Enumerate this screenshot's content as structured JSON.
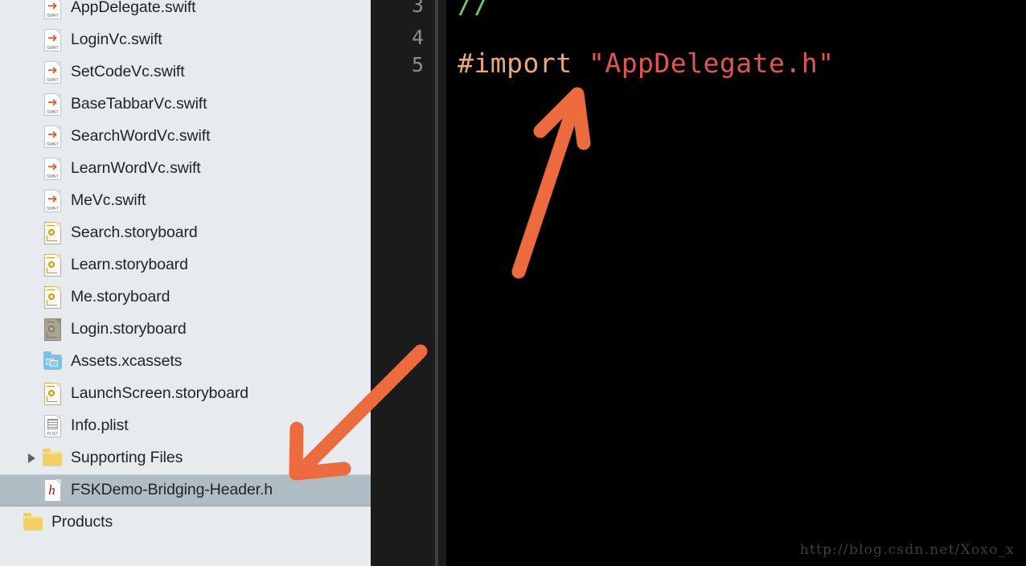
{
  "app": {
    "kind": "xcode-project-navigator-and-editor"
  },
  "sidebar": {
    "background_color": "#e7ebed",
    "selection_color": "#b0bcc3",
    "items": [
      {
        "label": "AppDelegate.swift",
        "icon": "swift-file-icon",
        "indent": 1,
        "twisty": false,
        "selected": false,
        "clipped": true
      },
      {
        "label": "LoginVc.swift",
        "icon": "swift-file-icon",
        "indent": 1,
        "twisty": false,
        "selected": false
      },
      {
        "label": "SetCodeVc.swift",
        "icon": "swift-file-icon",
        "indent": 1,
        "twisty": false,
        "selected": false
      },
      {
        "label": "BaseTabbarVc.swift",
        "icon": "swift-file-icon",
        "indent": 1,
        "twisty": false,
        "selected": false
      },
      {
        "label": "SearchWordVc.swift",
        "icon": "swift-file-icon",
        "indent": 1,
        "twisty": false,
        "selected": false
      },
      {
        "label": "LearnWordVc.swift",
        "icon": "swift-file-icon",
        "indent": 1,
        "twisty": false,
        "selected": false
      },
      {
        "label": "MeVc.swift",
        "icon": "swift-file-icon",
        "indent": 1,
        "twisty": false,
        "selected": false
      },
      {
        "label": "Search.storyboard",
        "icon": "storyboard-file-icon",
        "indent": 1,
        "twisty": false,
        "selected": false
      },
      {
        "label": "Learn.storyboard",
        "icon": "storyboard-file-icon",
        "indent": 1,
        "twisty": false,
        "selected": false
      },
      {
        "label": "Me.storyboard",
        "icon": "storyboard-file-icon",
        "indent": 1,
        "twisty": false,
        "selected": false
      },
      {
        "label": "Login.storyboard",
        "icon": "storyboard-file-icon-dimmed",
        "indent": 1,
        "twisty": false,
        "selected": false
      },
      {
        "label": "Assets.xcassets",
        "icon": "xcassets-folder-icon",
        "indent": 1,
        "twisty": false,
        "selected": false
      },
      {
        "label": "LaunchScreen.storyboard",
        "icon": "storyboard-file-icon",
        "indent": 1,
        "twisty": false,
        "selected": false
      },
      {
        "label": "Info.plist",
        "icon": "plist-file-icon",
        "indent": 1,
        "twisty": false,
        "selected": false
      },
      {
        "label": "Supporting Files",
        "icon": "folder-icon",
        "indent": 1,
        "twisty": true,
        "selected": false
      },
      {
        "label": "FSKDemo-Bridging-Header.h",
        "icon": "header-file-icon",
        "indent": 1,
        "twisty": false,
        "selected": true
      },
      {
        "label": "Products",
        "icon": "folder-icon",
        "indent": 0,
        "twisty": false,
        "selected": false
      }
    ]
  },
  "editor": {
    "background_color": "#000000",
    "gutter_color": "#1b1b1b",
    "lines": [
      {
        "number": "3",
        "tokens": [
          {
            "text": "//",
            "type": "comment"
          }
        ]
      },
      {
        "number": "4",
        "tokens": []
      },
      {
        "number": "5",
        "tokens": [
          {
            "text": "#import ",
            "type": "preproc"
          },
          {
            "text": "\"AppDelegate.h\"",
            "type": "string"
          }
        ]
      }
    ],
    "colors": {
      "comment": "#6fc96f",
      "preproc": "#e8a87c",
      "string": "#e0574f",
      "lineno": "#8d8d8d"
    },
    "watermark": "http://blog.csdn.net/Xoxo_x"
  },
  "annotations": {
    "color": "#ec6b3e",
    "arrows": [
      {
        "name": "arrow-to-import-line",
        "points_to": "#import \"AppDelegate.h\""
      },
      {
        "name": "arrow-to-bridging-header",
        "points_to": "FSKDemo-Bridging-Header.h"
      }
    ]
  }
}
